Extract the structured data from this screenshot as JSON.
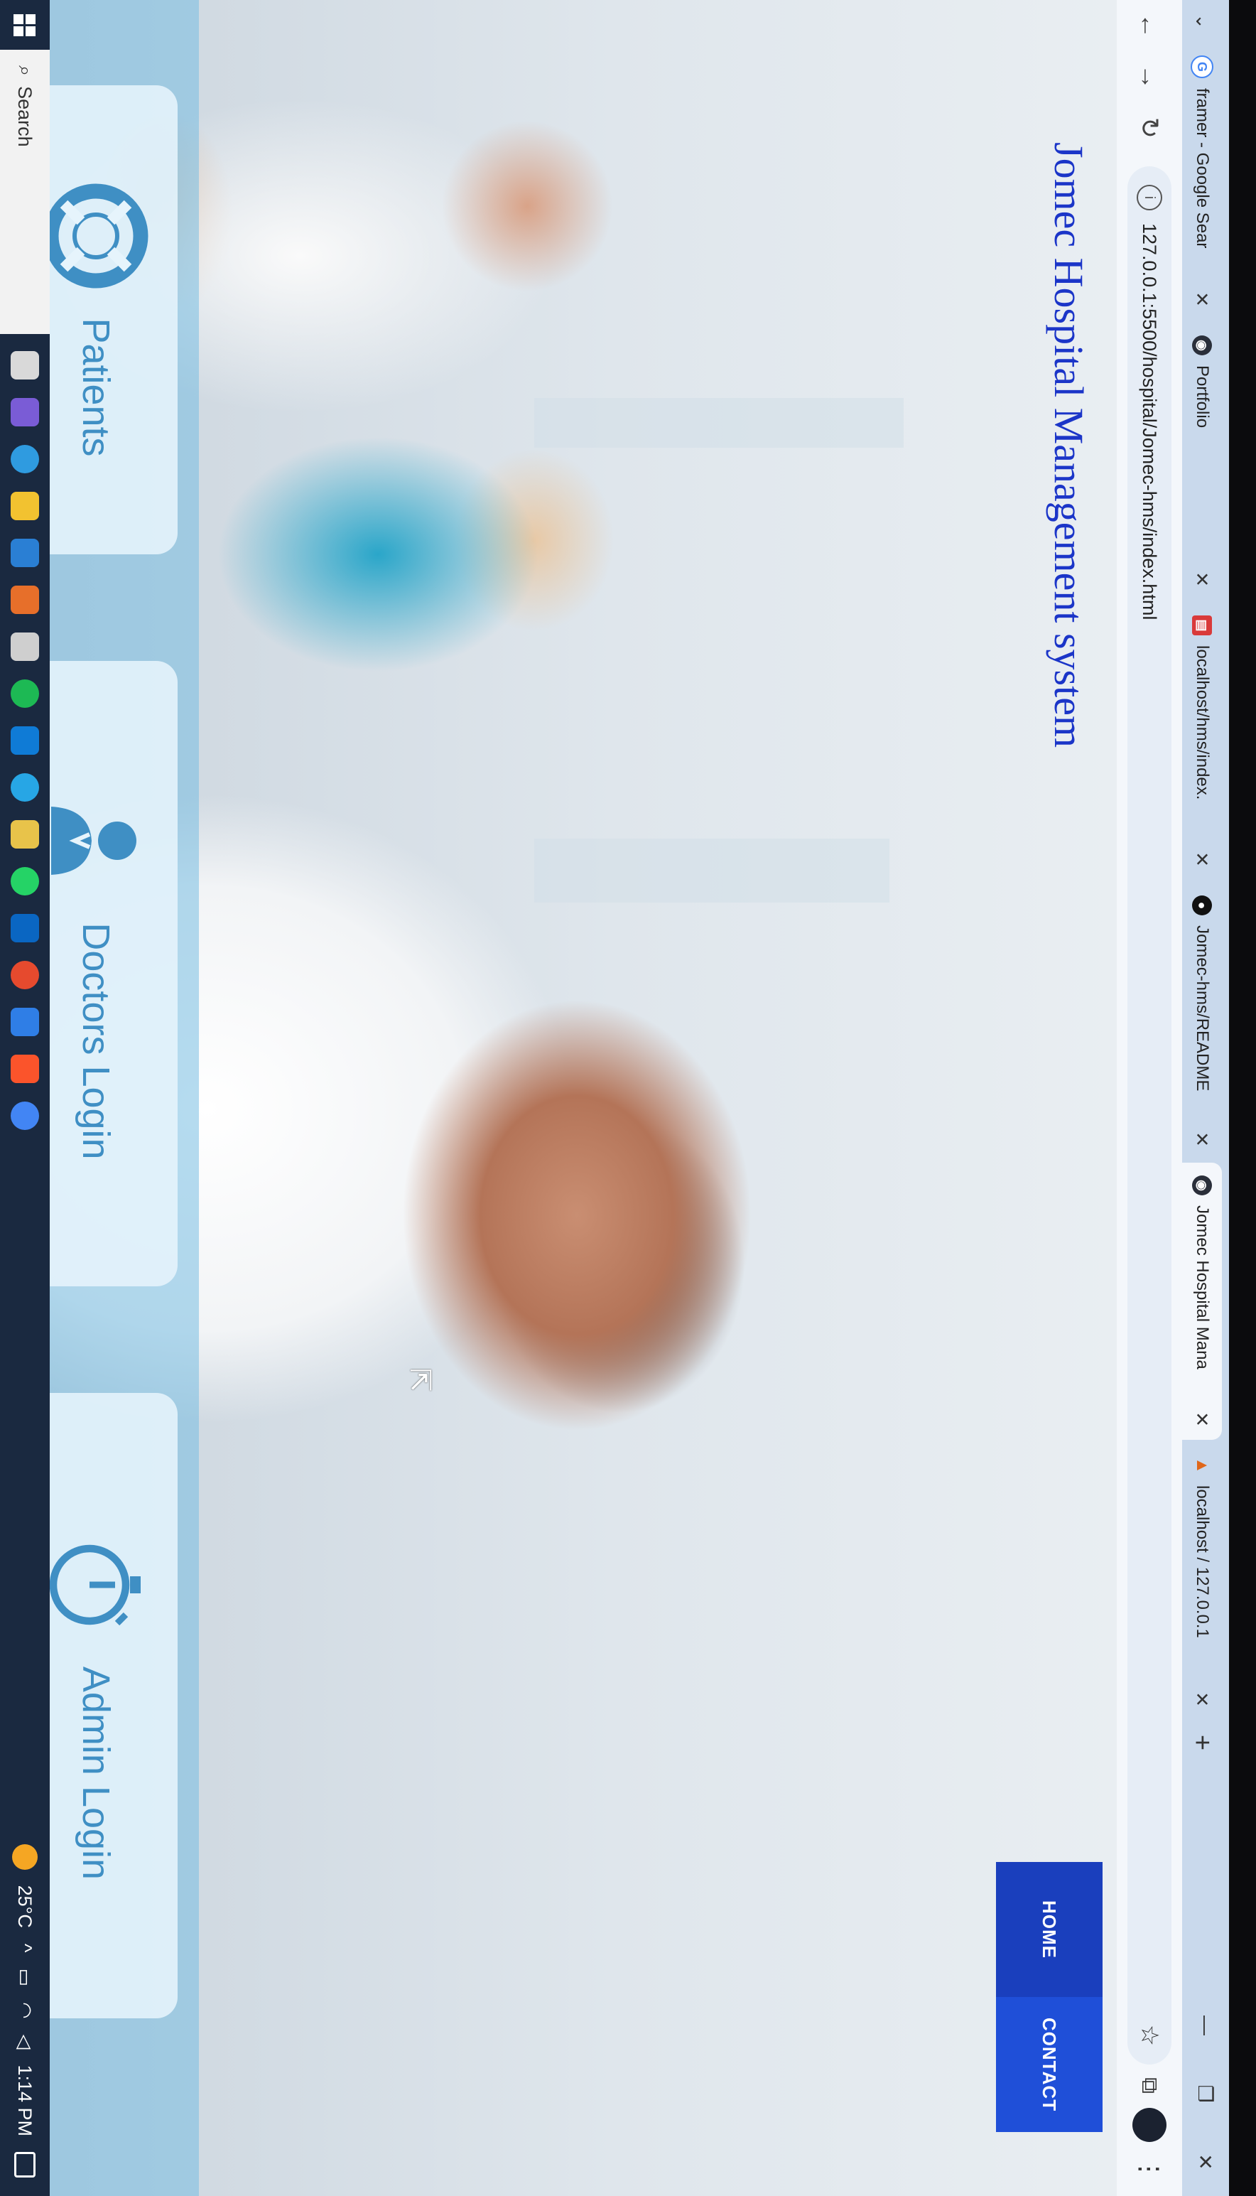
{
  "browser": {
    "tabs": [
      {
        "title": "framer - Google Sear",
        "favicon": "google-g-icon",
        "color": "#4285f4",
        "active": false
      },
      {
        "title": "Portfolio",
        "favicon": "globe-icon",
        "color": "#2a2f3a",
        "active": false
      },
      {
        "title": "localhost/hms/index.",
        "favicon": "page-icon",
        "color": "#d93a3a",
        "active": false
      },
      {
        "title": "Jomec-hms/README",
        "favicon": "github-icon",
        "color": "#111111",
        "active": false
      },
      {
        "title": "Jomec Hospital Mana",
        "favicon": "globe-icon",
        "color": "#2a2f3a",
        "active": true
      },
      {
        "title": "localhost / 127.0.0.1",
        "favicon": "phpmyadmin-icon",
        "color": "#e0671a",
        "active": false
      }
    ],
    "new_tab_label": "+",
    "address": "127.0.0.1:5500/hospital/Jomec-hms/index.html"
  },
  "site": {
    "title": "Jomec Hospital Management system",
    "nav": [
      "HOME",
      "CONTACT"
    ],
    "actions": [
      {
        "label": "Patients",
        "icon": "lifebuoy-icon"
      },
      {
        "label": "Doctors Login",
        "icon": "doctor-icon"
      },
      {
        "label": "Admin Login",
        "icon": "stopwatch-icon"
      }
    ]
  },
  "taskbar": {
    "search_label": "Search",
    "weather": "25°C",
    "time": "1:14 PM"
  },
  "colors": {
    "brand_blue": "#1b35c8",
    "nav_blue": "#1f4fd8",
    "action_text": "#3f8fc4"
  }
}
